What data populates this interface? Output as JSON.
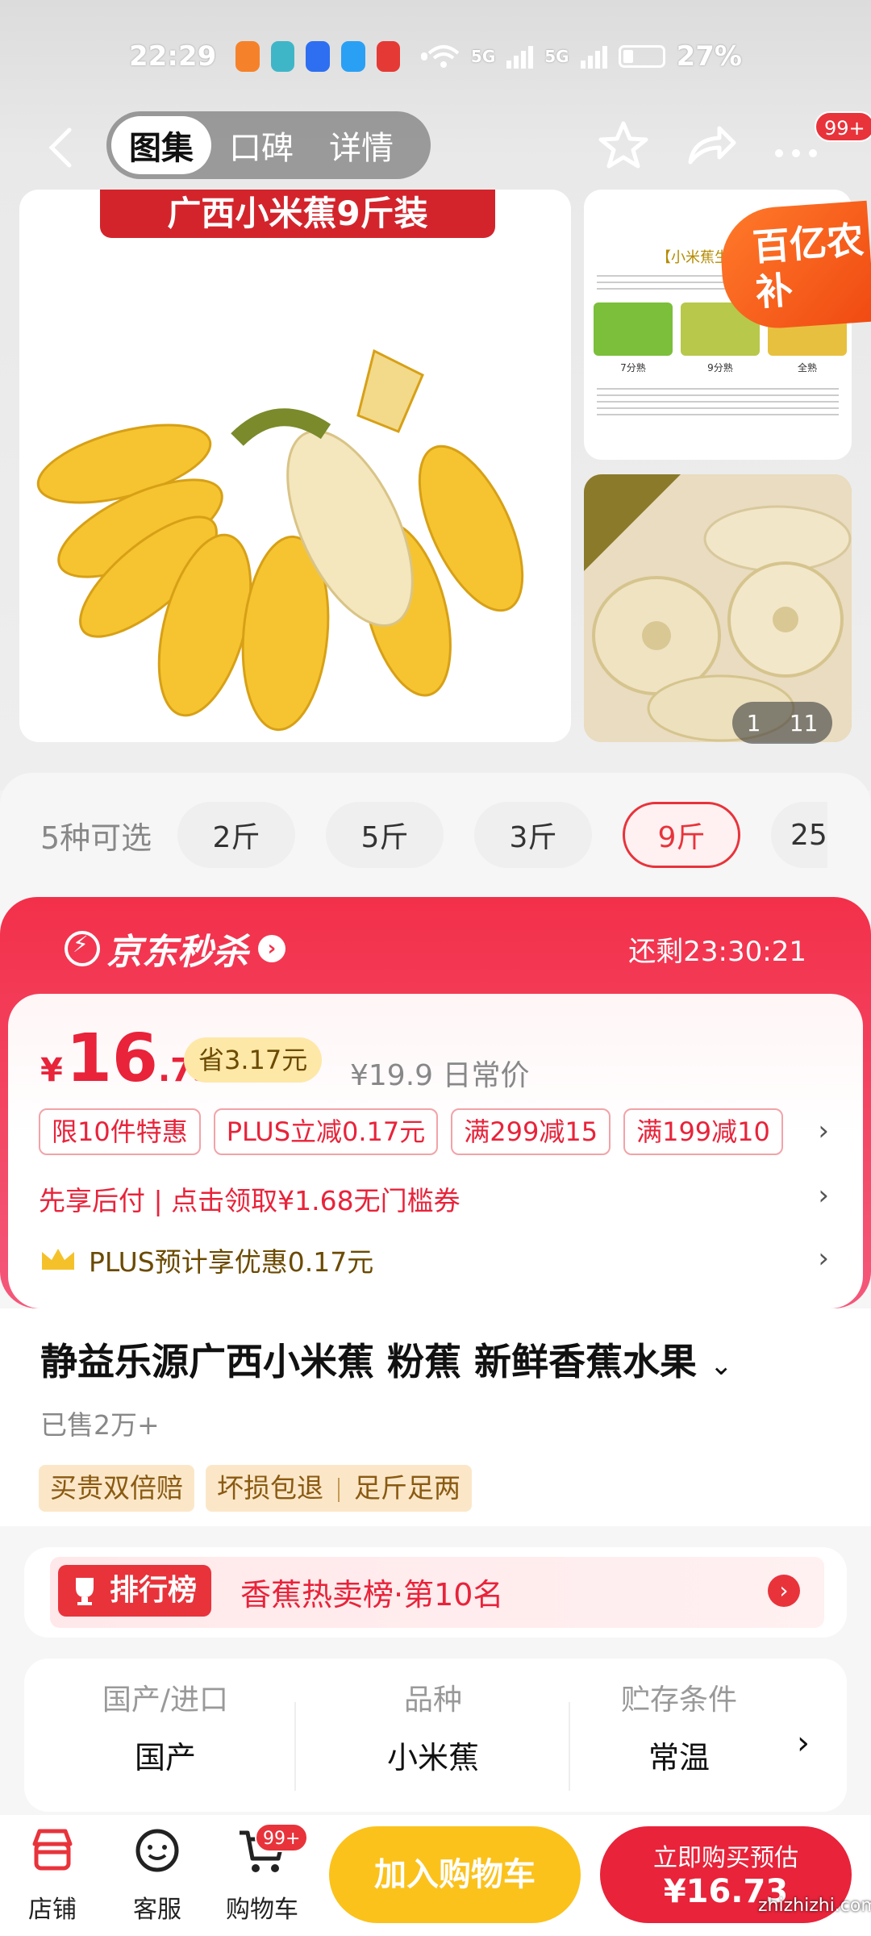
{
  "status_bar": {
    "time": "22:29",
    "network": "5G",
    "network2": "5G",
    "battery": "27%"
  },
  "nav": {
    "tabs": [
      {
        "label": "图集",
        "active": true
      },
      {
        "label": "口碑",
        "active": false
      },
      {
        "label": "详情",
        "active": false
      }
    ],
    "more_badge": "99+"
  },
  "gallery": {
    "main_banner": "广西小米蕉9斤装",
    "thumb1_title": "【小米蕉生",
    "thumb1_labels": [
      "7分熟",
      "9分熟",
      "全熟"
    ],
    "promo_tag": "百亿农补",
    "counter_current": "1",
    "counter_total": "11"
  },
  "options": {
    "label": "5种可选",
    "items": [
      {
        "label": "2斤",
        "selected": false
      },
      {
        "label": "5斤",
        "selected": false
      },
      {
        "label": "3斤",
        "selected": false
      },
      {
        "label": "9斤",
        "selected": true
      },
      {
        "label": "25",
        "selected": false
      }
    ]
  },
  "flash_sale": {
    "title": "京东秒杀",
    "timer": "还剩23:30:21",
    "price_symbol": "¥",
    "price_int": "16",
    "price_dec": ".73",
    "save": "省3.17元",
    "orig_price": "¥19.9 日常价",
    "tags": [
      "限10件特惠",
      "PLUS立减0.17元",
      "满299减15",
      "满199减10"
    ],
    "coupon": "先享后付 | 点击领取¥1.68无门槛券",
    "plus": "PLUS预计享优惠0.17元"
  },
  "product": {
    "title": "静益乐源广西小米蕉 粉蕉 新鲜香蕉水果",
    "sold": "已售2万+",
    "guarantees": [
      "买贵双倍赔",
      "坏损包退",
      "足斤足两"
    ]
  },
  "rank": {
    "badge": "排行榜",
    "text": "香蕉热卖榜·第10名"
  },
  "specs": [
    {
      "label": "国产/进口",
      "value": "国产"
    },
    {
      "label": "品种",
      "value": "小米蕉"
    },
    {
      "label": "贮存条件",
      "value": "常温"
    }
  ],
  "bottom_bar": {
    "store": "店铺",
    "service": "客服",
    "cart": "购物车",
    "cart_badge": "99+",
    "add_cart": "加入购物车",
    "buy_line1": "立即购买预估",
    "buy_line2": "¥16.73"
  },
  "watermark": "zhizhizhi.com",
  "colors": {
    "accent": "#e8333b",
    "flash": "#f3304a",
    "cart_button": "#fbc21c"
  }
}
